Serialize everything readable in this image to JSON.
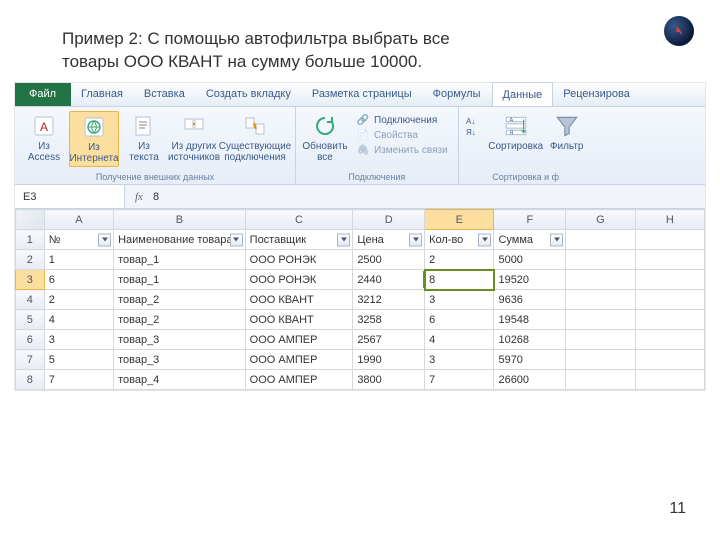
{
  "slide": {
    "title": "Пример 2: С помощью автофильтра выбрать все товары ООО КВАНТ на сумму больше 10000.",
    "page": "11"
  },
  "tabs": {
    "file": "Файл",
    "home": "Главная",
    "insert": "Вставка",
    "create": "Создать вкладку",
    "layout": "Разметка страницы",
    "formulas": "Формулы",
    "data": "Данные",
    "review": "Рецензирова"
  },
  "ribbon": {
    "group_get": {
      "access": "Из Access",
      "web": "Из Интернета",
      "text": "Из текста",
      "other": "Из других источников",
      "existing": "Существующие подключения",
      "label": "Получение внешних данных"
    },
    "group_conn": {
      "refresh": "Обновить все",
      "connections": "Подключения",
      "props": "Свойства",
      "links": "Изменить связи",
      "label": "Подключения"
    },
    "group_sort": {
      "sort": "Сортировка",
      "filter": "Фильтр",
      "label": "Сортировка и ф"
    }
  },
  "formula_bar": {
    "name": "E3",
    "fx": "fx",
    "value": "8"
  },
  "columns": [
    "A",
    "B",
    "C",
    "D",
    "E",
    "F",
    "G",
    "H"
  ],
  "headers": {
    "a": "№",
    "b": "Наименование товара",
    "c": "Поставщик",
    "d": "Цена",
    "e": "Кол-во",
    "f": "Сумма"
  },
  "rows": [
    {
      "n": "1",
      "name": "товар_1",
      "sup": "ООО РОНЭК",
      "price": "2500",
      "qty": "2",
      "sum": "5000"
    },
    {
      "n": "6",
      "name": "товар_1",
      "sup": "ООО РОНЭК",
      "price": "2440",
      "qty": "8",
      "sum": "19520"
    },
    {
      "n": "2",
      "name": "товар_2",
      "sup": "ООО КВАНТ",
      "price": "3212",
      "qty": "3",
      "sum": "9636"
    },
    {
      "n": "4",
      "name": "товар_2",
      "sup": "ООО КВАНТ",
      "price": "3258",
      "qty": "6",
      "sum": "19548"
    },
    {
      "n": "3",
      "name": "товар_3",
      "sup": "ООО АМПЕР",
      "price": "2567",
      "qty": "4",
      "sum": "10268"
    },
    {
      "n": "5",
      "name": "товар_3",
      "sup": "ООО АМПЕР",
      "price": "1990",
      "qty": "3",
      "sum": "5970"
    },
    {
      "n": "7",
      "name": "товар_4",
      "sup": "ООО АМПЕР",
      "price": "3800",
      "qty": "7",
      "sum": "26600"
    }
  ],
  "row_nums": [
    "1",
    "2",
    "3",
    "4",
    "5",
    "6",
    "7",
    "8"
  ],
  "selected_row_index": 1
}
